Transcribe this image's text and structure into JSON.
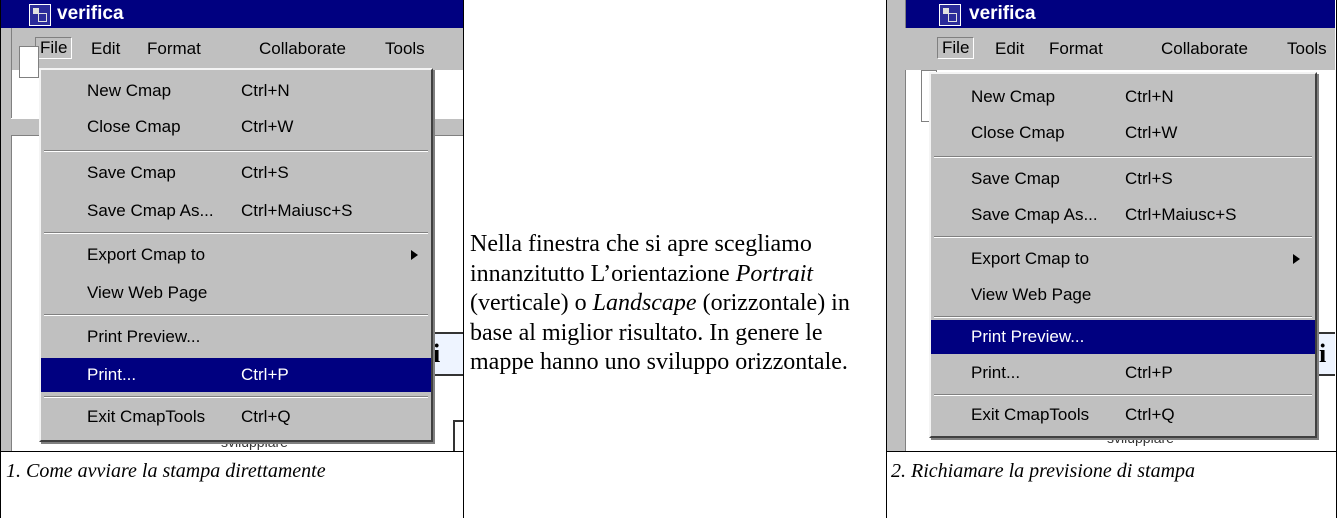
{
  "screenshot_1": {
    "window_title": "verifica",
    "menubar": [
      "File",
      "Edit",
      "Format",
      "Collaborate",
      "Tools"
    ],
    "background_box_text": "li",
    "background_label": "svilupplare",
    "file_menu": [
      {
        "label": "New Cmap",
        "shortcut": "Ctrl+N"
      },
      {
        "label": "Close Cmap",
        "shortcut": "Ctrl+W"
      },
      {
        "label": "Save Cmap",
        "shortcut": "Ctrl+S"
      },
      {
        "label": "Save Cmap As...",
        "shortcut": "Ctrl+Maiusc+S"
      },
      {
        "label": "Export Cmap to",
        "shortcut": ""
      },
      {
        "label": "View Web Page",
        "shortcut": ""
      },
      {
        "label": "Print Preview...",
        "shortcut": ""
      },
      {
        "label": "Print...",
        "shortcut": "Ctrl+P"
      },
      {
        "label": "Exit CmapTools",
        "shortcut": "Ctrl+Q"
      }
    ],
    "selected_item": "Print...",
    "caption": "1. Come avviare la stampa direttamente"
  },
  "screenshot_2": {
    "window_title": "verifica",
    "menubar": [
      "File",
      "Edit",
      "Format",
      "Collaborate",
      "Tools"
    ],
    "background_box_text": "li",
    "background_label": "svilupplare",
    "file_menu": [
      {
        "label": "New Cmap",
        "shortcut": "Ctrl+N"
      },
      {
        "label": "Close Cmap",
        "shortcut": "Ctrl+W"
      },
      {
        "label": "Save Cmap",
        "shortcut": "Ctrl+S"
      },
      {
        "label": "Save Cmap As...",
        "shortcut": "Ctrl+Maiusc+S"
      },
      {
        "label": "Export Cmap to",
        "shortcut": ""
      },
      {
        "label": "View Web Page",
        "shortcut": ""
      },
      {
        "label": "Print Preview...",
        "shortcut": ""
      },
      {
        "label": "Print...",
        "shortcut": "Ctrl+P"
      },
      {
        "label": "Exit CmapTools",
        "shortcut": "Ctrl+Q"
      }
    ],
    "selected_item": "Print Preview...",
    "caption": "2. Richiamare la previsione di stampa"
  },
  "paragraph": {
    "text_1": "Nella finestra che si apre scegliamo innanzitutto L’orientazione ",
    "italic_1": "Portrait",
    "text_2": " (verticale) o ",
    "italic_2": "Landscape",
    "text_3": " (orizzontale) in base al miglior risultato. In genere le mappe hanno uno sviluppo orizzontale."
  },
  "colors": {
    "menu_gray": "#c0c0c0",
    "selection_blue": "#000080"
  }
}
